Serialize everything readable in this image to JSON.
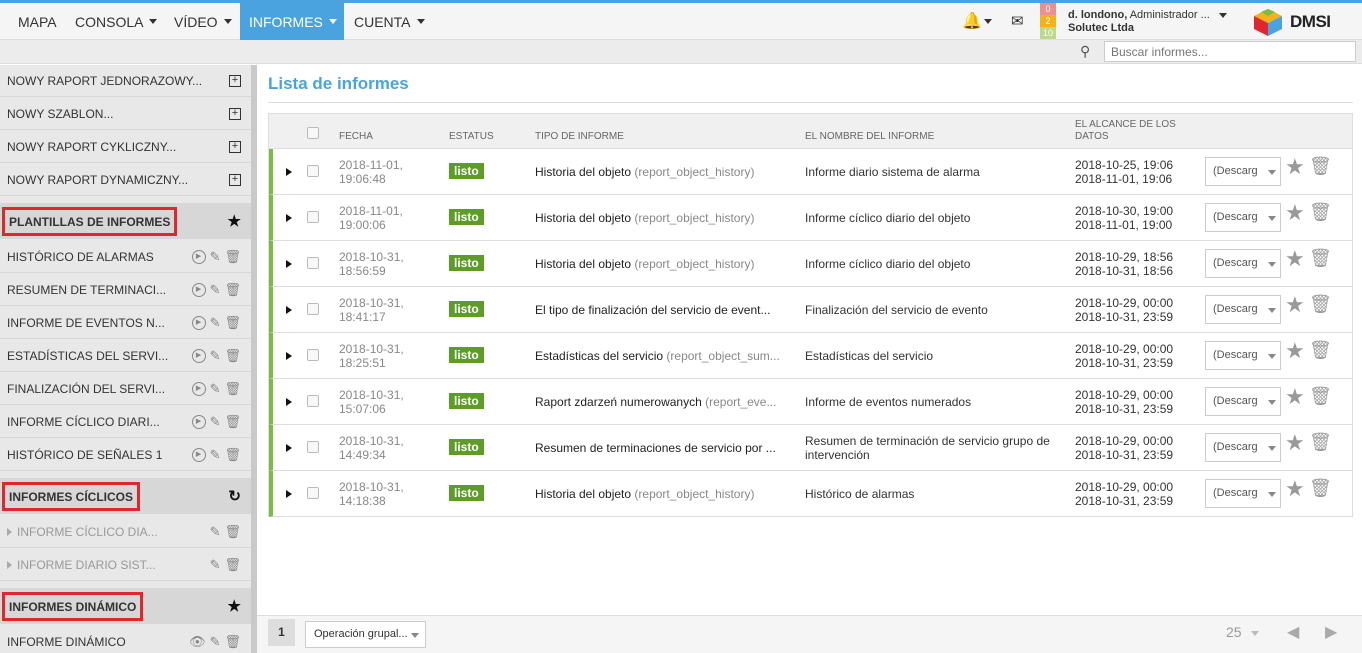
{
  "nav": {
    "items": [
      {
        "label": "MAPA"
      },
      {
        "label": "CONSOLA"
      },
      {
        "label": "VÍDEO"
      },
      {
        "label": "INFORMES"
      },
      {
        "label": "CUENTA"
      }
    ],
    "counters": [
      "0",
      "2",
      "10"
    ],
    "user_name": "d. londono,",
    "user_role": "Administrador ...",
    "user_company": "Solutec Ltda",
    "logo_text": "DMSI",
    "accent": "#4aa3df"
  },
  "search": {
    "placeholder": "Buscar informes..."
  },
  "sidebar": {
    "new_items": [
      {
        "label": "NOWY RAPORT JEDNORAZOWY..."
      },
      {
        "label": "NOWY SZABLON..."
      },
      {
        "label": "NOWY RAPORT CYKLICZNY..."
      },
      {
        "label": "NOWY RAPORT DYNAMICZNY..."
      }
    ],
    "templates_header": "PLANTILLAS DE INFORMES",
    "templates": [
      {
        "label": "HISTÓRICO DE ALARMAS"
      },
      {
        "label": "RESUMEN DE TERMINACI..."
      },
      {
        "label": "INFORME DE EVENTOS N..."
      },
      {
        "label": "ESTADÍSTICAS DEL SERVI..."
      },
      {
        "label": "FINALIZACIÓN DEL SERVI..."
      },
      {
        "label": "INFORME CÍCLICO DIARI..."
      },
      {
        "label": "HISTÓRICO DE SEÑALES 1"
      }
    ],
    "cyclic_header": "INFORMES CÍCLICOS",
    "cyclic": [
      {
        "label": "INFORME CÍCLICO DIA..."
      },
      {
        "label": "INFORME DIARIO SIST..."
      }
    ],
    "dynamic_header": "INFORMES DINÁMICO",
    "dynamic": [
      {
        "label": "INFORME DINÁMICO"
      }
    ]
  },
  "main": {
    "title": "Lista de informes",
    "columns": {
      "fecha": "FECHA",
      "estatus": "ESTATUS",
      "tipo": "TIPO DE INFORME",
      "nombre": "EL NOMBRE DEL INFORME",
      "alcance": "EL ALCANCE DE LOS DATOS"
    },
    "rows": [
      {
        "date1": "2018-11-01,",
        "date2": "19:06:48",
        "status": "listo",
        "type": "Historia del objeto",
        "type_code": "(report_object_history)",
        "name": "Informe diario sistema de alarma",
        "range1": "2018-10-25, 19:06",
        "range2": "2018-11-01, 19:06",
        "action": "(Descarg"
      },
      {
        "date1": "2018-11-01,",
        "date2": "19:00:06",
        "status": "listo",
        "type": "Historia del objeto",
        "type_code": "(report_object_history)",
        "name": "Informe cíclico diario del objeto",
        "range1": "2018-10-30, 19:00",
        "range2": "2018-11-01, 19:00",
        "action": "(Descarg"
      },
      {
        "date1": "2018-10-31,",
        "date2": "18:56:59",
        "status": "listo",
        "type": "Historia del objeto",
        "type_code": "(report_object_history)",
        "name": "Informe cíclico diario del objeto",
        "range1": "2018-10-29, 18:56",
        "range2": "2018-10-31, 18:56",
        "action": "(Descarg"
      },
      {
        "date1": "2018-10-31,",
        "date2": "18:41:17",
        "status": "listo",
        "type": "El tipo de finalización del servicio de event...",
        "type_code": "",
        "name": "Finalización del servicio de evento",
        "range1": "2018-10-29, 00:00",
        "range2": "2018-10-31, 23:59",
        "action": "(Descarg"
      },
      {
        "date1": "2018-10-31,",
        "date2": "18:25:51",
        "status": "listo",
        "type": "Estadísticas del servicio",
        "type_code": "(report_object_sum...",
        "name": "Estadísticas del servicio",
        "range1": "2018-10-29, 00:00",
        "range2": "2018-10-31, 23:59",
        "action": "(Descarg"
      },
      {
        "date1": "2018-10-31,",
        "date2": "15:07:06",
        "status": "listo",
        "type": "Raport zdarzeń numerowanych",
        "type_code": "(report_eve...",
        "name": "Informe de eventos numerados",
        "range1": "2018-10-29, 00:00",
        "range2": "2018-10-31, 23:59",
        "action": "(Descarg"
      },
      {
        "date1": "2018-10-31,",
        "date2": "14:49:34",
        "status": "listo",
        "type": "Resumen de terminaciones de servicio por ...",
        "type_code": "",
        "name": "Resumen de terminación de servicio grupo de intervención",
        "range1": "2018-10-29, 00:00",
        "range2": "2018-10-31, 23:59",
        "action": "(Descarg"
      },
      {
        "date1": "2018-10-31,",
        "date2": "14:18:38",
        "status": "listo",
        "type": "Historia del objeto",
        "type_code": "(report_object_history)",
        "name": "Histórico de alarmas",
        "range1": "2018-10-29, 00:00",
        "range2": "2018-10-31, 23:59",
        "action": "(Descarg"
      }
    ]
  },
  "footer": {
    "page": "1",
    "group_op": "Operación grupal...",
    "per_page": "25"
  }
}
